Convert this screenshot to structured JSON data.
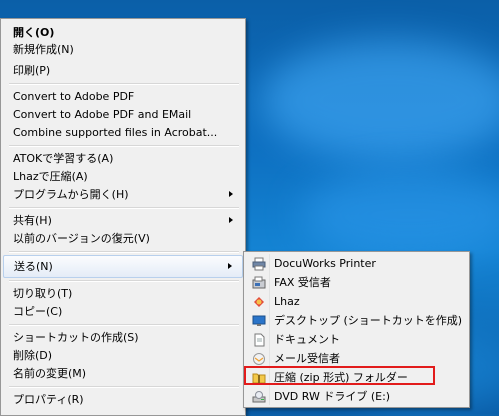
{
  "context_menu": {
    "items": [
      {
        "label": "開く(O)"
      },
      {
        "label": "新規作成(N)"
      },
      {
        "label": "印刷(P)"
      },
      {
        "label": "Convert to Adobe PDF"
      },
      {
        "label": "Convert to Adobe PDF and EMail"
      },
      {
        "label": "Combine supported files in Acrobat..."
      },
      {
        "label": "ATOKで学習する(A)"
      },
      {
        "label": "Lhazで圧縮(A)"
      },
      {
        "label": "プログラムから開く(H)"
      },
      {
        "label": "共有(H)"
      },
      {
        "label": "以前のバージョンの復元(V)"
      },
      {
        "label": "送る(N)"
      },
      {
        "label": "切り取り(T)"
      },
      {
        "label": "コピー(C)"
      },
      {
        "label": "ショートカットの作成(S)"
      },
      {
        "label": "削除(D)"
      },
      {
        "label": "名前の変更(M)"
      },
      {
        "label": "プロパティ(R)"
      }
    ]
  },
  "send_to_menu": {
    "items": [
      {
        "label": "DocuWorks Printer",
        "icon": "printer-icon"
      },
      {
        "label": "FAX 受信者",
        "icon": "fax-icon"
      },
      {
        "label": "Lhaz",
        "icon": "lhaz-icon"
      },
      {
        "label": "デスクトップ (ショートカットを作成)",
        "icon": "desktop-icon"
      },
      {
        "label": "ドキュメント",
        "icon": "documents-icon"
      },
      {
        "label": "メール受信者",
        "icon": "mail-icon"
      },
      {
        "label": "圧縮 (zip 形式) フォルダー",
        "icon": "zip-folder-icon"
      },
      {
        "label": "DVD RW ドライブ (E:)",
        "icon": "dvd-drive-icon"
      }
    ]
  },
  "colors": {
    "highlight_box": "#e21b1b",
    "menu_bg": "#f0f0f0"
  }
}
